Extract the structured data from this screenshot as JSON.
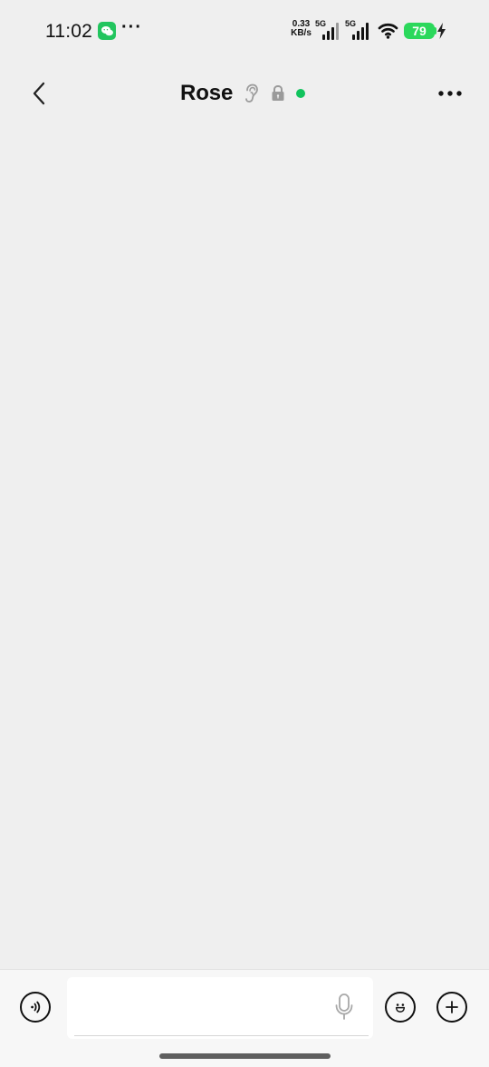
{
  "status_bar": {
    "time": "11:02",
    "more": "···",
    "network_speed": {
      "value": "0.33",
      "unit": "KB/s"
    },
    "signal_1_label": "5G",
    "signal_2_label": "5G",
    "battery": "79"
  },
  "header": {
    "title": "Rose"
  },
  "chat": {
    "messages": []
  },
  "composer": {
    "value": "",
    "placeholder": ""
  },
  "colors": {
    "background": "#efefef",
    "online": "#11c35d",
    "battery": "#2bd85b"
  }
}
